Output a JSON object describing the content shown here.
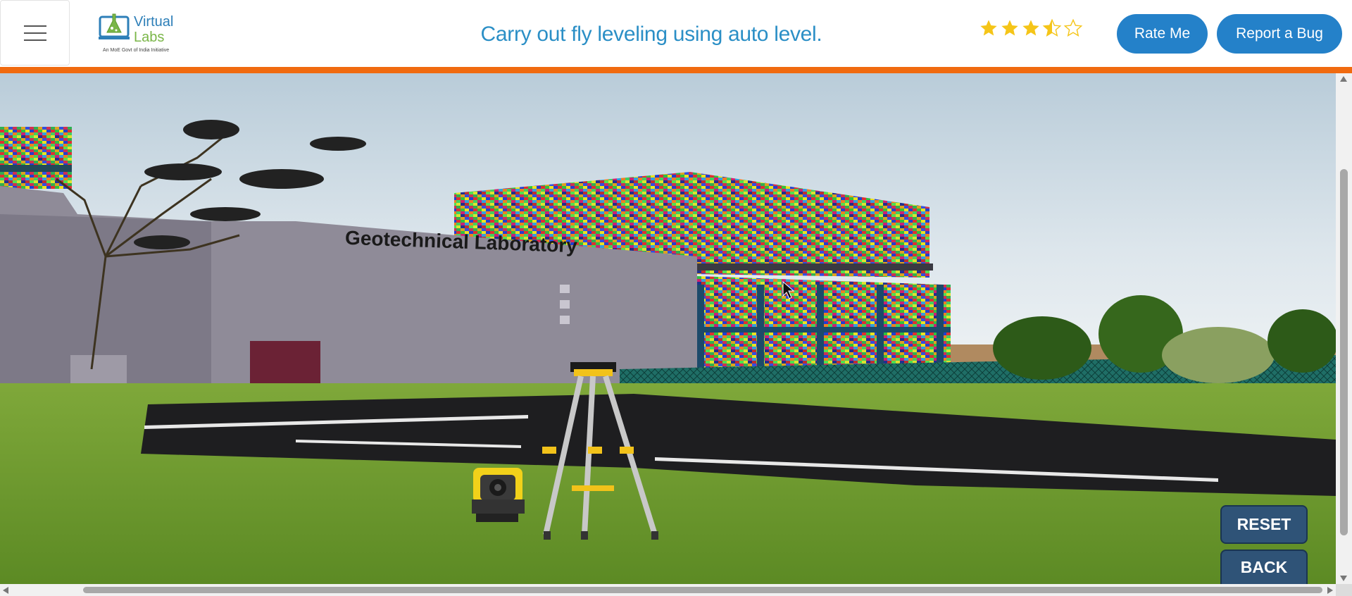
{
  "header": {
    "menu_icon": "hamburger-menu-icon",
    "logo": {
      "line1": "Virtual",
      "line2": "Labs",
      "tagline": "An MoE Govt of India Initiative"
    },
    "title": "Carry out fly leveling using auto level.",
    "rating": {
      "value": 3.5,
      "max": 5
    },
    "rate_label": "Rate Me",
    "bug_label": "Report a Bug",
    "brand_color": "#2481c9",
    "accent_bar_color": "#f06a0f"
  },
  "scene": {
    "building_sign": "Geotechnical Laboratory",
    "objects": [
      "auto-level-instrument",
      "tripod",
      "building",
      "trees",
      "road",
      "fence",
      "shrubs"
    ]
  },
  "controls": {
    "reset_label": "RESET",
    "back_label": "BACK"
  }
}
